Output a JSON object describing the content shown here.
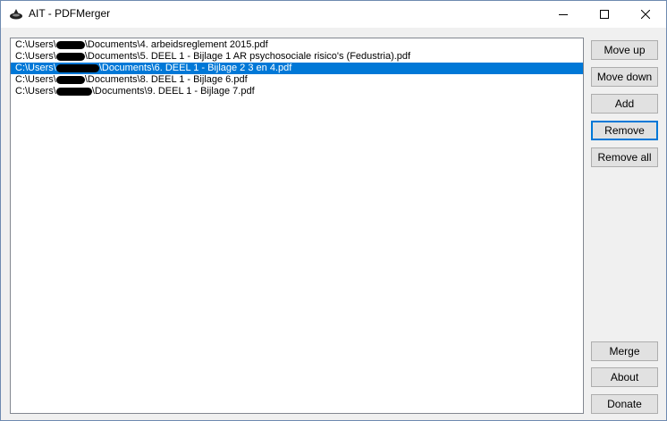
{
  "window": {
    "title": "AIT - PDFMerger",
    "icon": "ink-blot-icon"
  },
  "caption_buttons": {
    "minimize": "minimize-icon",
    "maximize": "maximize-icon",
    "close": "close-icon"
  },
  "file_list": {
    "selected_index": 2,
    "items": [
      {
        "prefix": "C:\\Users\\",
        "suffix": "\\Documents\\4. arbeidsreglement 2015.pdf"
      },
      {
        "prefix": "C:\\Users\\",
        "suffix": "\\Documents\\5. DEEL 1 - Bijlage 1 AR psychosociale risico's (Fedustria).pdf"
      },
      {
        "prefix": "C:\\Users\\",
        "suffix": "\\Documents\\6. DEEL 1 - Bijlage 2 3 en 4.pdf"
      },
      {
        "prefix": "C:\\Users\\",
        "suffix": "\\Documents\\8. DEEL 1 - Bijlage 6.pdf"
      },
      {
        "prefix": "C:\\Users\\",
        "suffix": "\\Documents\\9. DEEL 1 - Bijlage 7.pdf"
      }
    ]
  },
  "buttons": {
    "move_up": "Move up",
    "move_down": "Move down",
    "add": "Add",
    "remove": "Remove",
    "remove_all": "Remove all",
    "merge": "Merge",
    "about": "About",
    "donate": "Donate"
  },
  "colors": {
    "selection": "#0078d7",
    "button_face": "#e1e1e1",
    "focus_border": "#0078d7"
  }
}
